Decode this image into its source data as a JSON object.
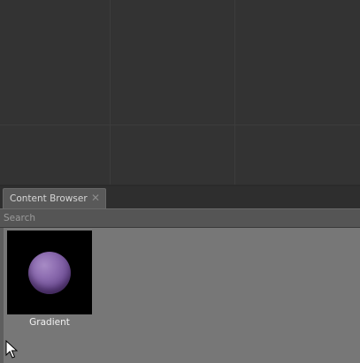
{
  "content_browser": {
    "tab_label": "Content Browser",
    "close_glyph": "✕",
    "search_placeholder": "Search",
    "assets": [
      {
        "name": "Gradient",
        "thumbnail_icon": "sphere-material-preview",
        "color": "#8f6fb2"
      }
    ]
  },
  "colors": {
    "viewport_bg": "#333333",
    "tab_bg": "#595959",
    "content_bg": "#777777",
    "thumb_bg": "#000000"
  }
}
